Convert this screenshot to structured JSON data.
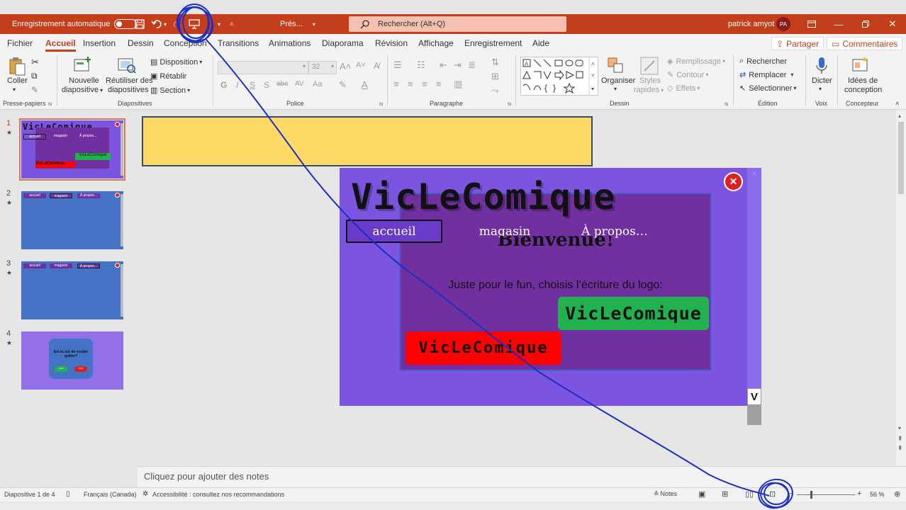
{
  "titlebar": {
    "autosave_label": "Enregistrement automatique",
    "doc_title": "Prés...",
    "search_placeholder": "Rechercher (Alt+Q)",
    "user_name": "patrick amyot",
    "user_initials": "PA"
  },
  "menu": {
    "tabs": [
      "Fichier",
      "Accueil",
      "Insertion",
      "Dessin",
      "Conception",
      "Transitions",
      "Animations",
      "Diaporama",
      "Révision",
      "Affichage",
      "Enregistrement",
      "Aide"
    ],
    "share": "Partager",
    "comments": "Commentaires"
  },
  "ribbon": {
    "clipboard": {
      "paste": "Coller",
      "group": "Presse-papiers"
    },
    "slides": {
      "new_slide_1": "Nouvelle",
      "new_slide_2": "diapositive",
      "reuse_1": "Réutiliser des",
      "reuse_2": "diapositives",
      "layout": "Disposition",
      "reset": "Rétablir",
      "section": "Section",
      "group": "Diapositives"
    },
    "font": {
      "size": "32",
      "bold": "G",
      "italic": "I",
      "underline": "S",
      "shadow": "S",
      "strike": "abc",
      "spacing": "AV",
      "case": "Aa",
      "group": "Police"
    },
    "paragraph": {
      "group": "Paragraphe"
    },
    "drawing": {
      "arrange": "Organiser",
      "styles_1": "Styles",
      "styles_2": "rapides",
      "fill": "Remplissage",
      "outline": "Contour",
      "effects": "Effets",
      "group": "Dessin"
    },
    "editing": {
      "find": "Rechercher",
      "replace": "Remplacer",
      "select": "Sélectionner",
      "group": "Édition"
    },
    "voice": {
      "dictate": "Dicter",
      "group": "Voix"
    },
    "designer": {
      "ideas_1": "Idées de",
      "ideas_2": "conception",
      "group": "Concepteur"
    }
  },
  "thumbnails": [
    {
      "num": "1",
      "logo": "VicLeComique",
      "nav": [
        "accueil",
        "magasin",
        "À propos..."
      ],
      "green": "VicLeComique",
      "red": "VicLeComique"
    },
    {
      "num": "2",
      "nav": [
        "accueil",
        "magasin",
        "À propos..."
      ]
    },
    {
      "num": "3",
      "nav": [
        "accueil",
        "magasin",
        "À propos..."
      ]
    },
    {
      "num": "4",
      "question": "Est-tu sûr de vouloir quitter?",
      "yes": "oui",
      "no": "non"
    }
  ],
  "slide": {
    "logo": "VicLeComique",
    "nav": {
      "home": "accueil",
      "shop": "magasin",
      "about": "À propos…"
    },
    "welcome": "Bienvenue!",
    "prompt": "Juste pour le fun, choisis l’écriture du logo:",
    "green_logo": "VicLeComique",
    "red_logo": "VicLeComique",
    "scroll_down": "V"
  },
  "notes": {
    "placeholder": "Cliquez pour ajouter des notes"
  },
  "status": {
    "slide_count": "Diapositive 1 de 4",
    "language": "Français (Canada)",
    "accessibility": "Accessibilité : consultez nos recommandations",
    "notes": "Notes",
    "zoom": "56 %"
  },
  "colors": {
    "accent": "#c43e1c",
    "slide_bg": "#7b54e0",
    "slide_inner": "#7030a0",
    "yellow_box": "#ffd966",
    "green_btn": "#21b14f",
    "red_btn": "#ff0000",
    "annotation_ink": "#1a2fc8"
  }
}
